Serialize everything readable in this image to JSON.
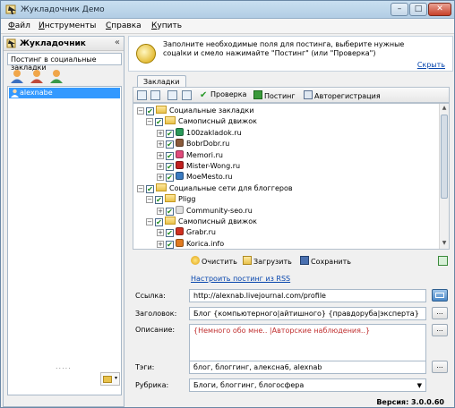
{
  "window": {
    "title": "Жукладочник Демо",
    "controls": {
      "minimize": "–",
      "maximize": "□",
      "close": "✕"
    }
  },
  "menu": [
    "Файл",
    "Инструменты",
    "Справка",
    "Купить"
  ],
  "left_panel": {
    "title": "Жукладочник",
    "collapse": "«",
    "subtitle": "Постинг в социальные закладки",
    "accounts": [
      "alexnabe"
    ],
    "splitter": "....."
  },
  "info": {
    "message": "Заполните необходимые поля для постинга, выберите нужные соцalки и смело нажимайте \"Постинг\" (или \"Проверка\")",
    "hide_link": "Скрыть"
  },
  "tabs": [
    "Закладки"
  ],
  "toolbar": {
    "check": "Проверка",
    "post": "Постинг",
    "autoreg": "Авторегистрация"
  },
  "tree": [
    {
      "label": "Социальные закладки",
      "level": 0,
      "type": "folder"
    },
    {
      "label": "Самописный движок",
      "level": 1,
      "type": "folder"
    },
    {
      "label": "100zakladok.ru",
      "level": 2,
      "type": "site",
      "color": "#2a9a5a"
    },
    {
      "label": "BobrDobr.ru",
      "level": 2,
      "type": "site",
      "color": "#8a5a3a"
    },
    {
      "label": "Memori.ru",
      "level": 2,
      "type": "site",
      "color": "#e04a7a"
    },
    {
      "label": "Mister-Wong.ru",
      "level": 2,
      "type": "site",
      "color": "#c02020"
    },
    {
      "label": "MoeMesto.ru",
      "level": 2,
      "type": "site",
      "color": "#3a7ac0"
    },
    {
      "label": "Социальные сети для блоггеров",
      "level": 0,
      "type": "folder"
    },
    {
      "label": "Pligg",
      "level": 1,
      "type": "folder"
    },
    {
      "label": "Community-seo.ru",
      "level": 2,
      "type": "site",
      "color": "#e0e0e0"
    },
    {
      "label": "Самописный движок",
      "level": 1,
      "type": "folder"
    },
    {
      "label": "Grabr.ru",
      "level": 2,
      "type": "site",
      "color": "#d03020"
    },
    {
      "label": "Korica.info",
      "level": 2,
      "type": "site",
      "color": "#e07a20"
    }
  ],
  "actions": {
    "clear": "Очистить",
    "load": "Загрузить",
    "save": "Сохранить"
  },
  "rss_link": "Настроить постинг из RSS",
  "form": {
    "link_label": "Ссылка:",
    "link_value": "http://alexnab.livejournal.com/profile",
    "title_label": "Заголовок:",
    "title_value": "Блог {компьютерного|айтишного} {правдоруба|эксперта}",
    "desc_label": "Описание:",
    "desc_value": "{Немного обо мне.. |Авторские наблюдения..}",
    "tags_label": "Тэги:",
    "tags_value": "блог, блоггинг, алексна6, alexnab",
    "rubric_label": "Рубрика:",
    "rubric_value": "Блоги, блоггинг, блогосфера",
    "more_btn": "..."
  },
  "version": "Версия: 3.0.0.60"
}
